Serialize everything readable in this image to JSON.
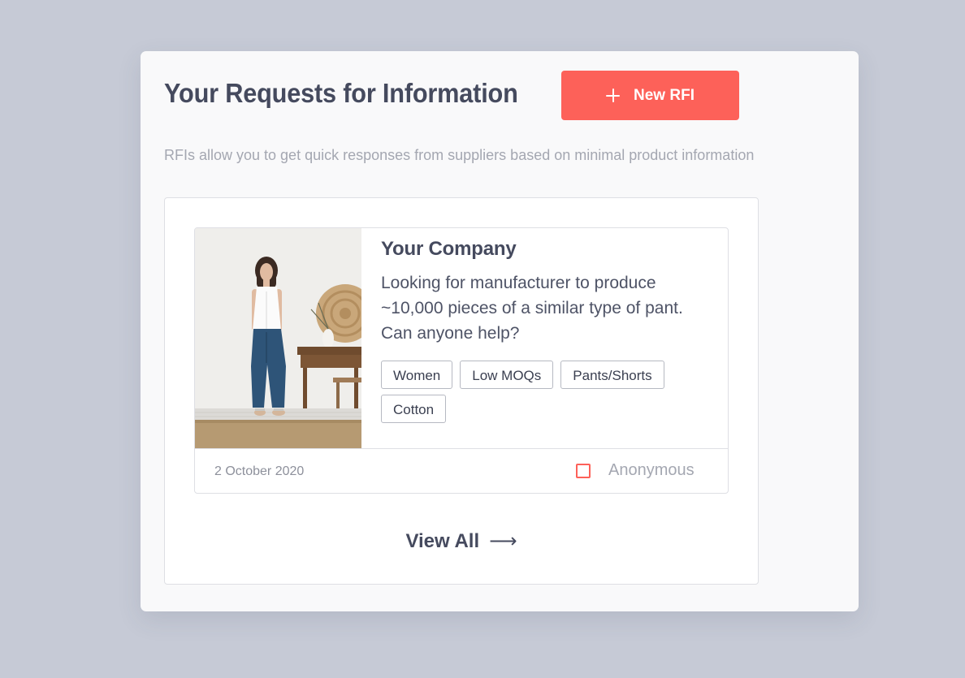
{
  "header": {
    "title": "Your Requests for Information",
    "new_button_label": "New RFI",
    "subtitle": "RFIs allow you to get quick responses from suppliers based on minimal product information"
  },
  "rfi": {
    "company": "Your Company",
    "description": "Looking for manufacturer to produce ~10,000 pieces of a similar type of pant. Can anyone help?",
    "tags": [
      "Women",
      "Low MOQs",
      "Pants/Shorts",
      "Cotton"
    ],
    "date": "2 October 2020",
    "anonymous_label": "Anonymous",
    "anonymous_checked": false
  },
  "footer": {
    "view_all_label": "View All"
  },
  "icons": {
    "plus": "plus-icon",
    "arrow": "arrow-right-icon",
    "checkbox": "checkbox-icon"
  },
  "colors": {
    "accent": "#fd6159",
    "text_dark": "#454a5e",
    "text_muted": "#a4a7b1",
    "background": "#c6cad6"
  }
}
